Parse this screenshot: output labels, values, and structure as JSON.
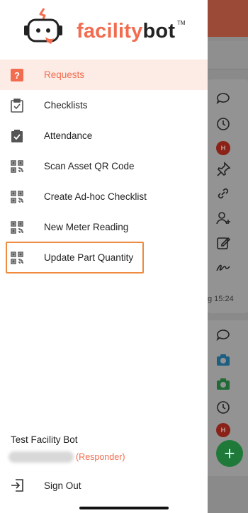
{
  "brand": {
    "name_part1": "facility",
    "name_part2": "bot",
    "trademark": "TM",
    "accent": "#f26c4f"
  },
  "menu": [
    {
      "label": "Requests",
      "icon": "question-icon",
      "active": true
    },
    {
      "label": "Checklists",
      "icon": "clipboard-check-icon",
      "active": false
    },
    {
      "label": "Attendance",
      "icon": "clipboard-filled-check-icon",
      "active": false
    },
    {
      "label": "Scan Asset QR Code",
      "icon": "qr-code-icon",
      "active": false
    },
    {
      "label": "Create Ad-hoc Checklist",
      "icon": "qr-code-icon",
      "active": false
    },
    {
      "label": "New Meter Reading",
      "icon": "qr-code-icon",
      "active": false
    },
    {
      "label": "Update Part Quantity",
      "icon": "qr-code-icon",
      "active": false,
      "highlighted": true
    }
  ],
  "user": {
    "name": "Test Facility Bot",
    "role": "(Responder)"
  },
  "signout": {
    "label": "Sign Out"
  },
  "background": {
    "timestamp": "g 15:24",
    "avatar_initial": "H"
  }
}
